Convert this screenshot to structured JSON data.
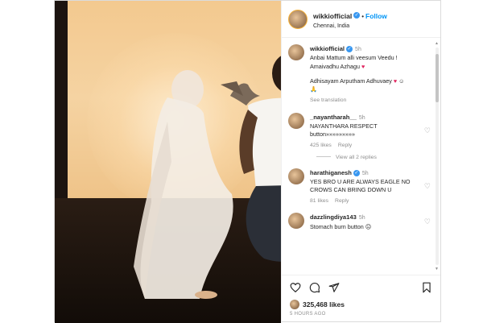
{
  "post": {
    "username": "wikkiofficial",
    "follow_label": "Follow",
    "location": "Chennai, India"
  },
  "comments": [
    {
      "username": "wikkiofficial",
      "time": "5h",
      "text_line1": "Anbai Mattum alli veesum Veedu !",
      "text_line2": "Amaivadhu Azhagu",
      "text_line3": "Adhisayam Arputham Adhuvaey",
      "extra_line": "🙏",
      "see_translation": "See translation"
    },
    {
      "username": "_nayantharah__",
      "time": "5h",
      "text_line1": "NAYANTHARA RESPECT",
      "text_line2": "button»»»»»»»»»",
      "likes": "425 likes",
      "reply": "Reply",
      "view_replies": "View all 2 replies"
    },
    {
      "username": "harathiganesh",
      "time": "5h",
      "text": "YES BRO U ARE ALWAYS EAGLE NO CROWS CAN BRING DOWN U",
      "likes": "81 likes",
      "reply": "Reply"
    },
    {
      "username": "dazzlingdiya143",
      "time": "5h",
      "text": "Stomach burn button"
    }
  ],
  "footer": {
    "likes_count": "325,468 likes",
    "time_ago": "5 HOURS AGO"
  },
  "icons": [
    "heart-icon",
    "comment-icon",
    "share-icon",
    "bookmark-icon",
    "verified-icon"
  ],
  "colors": {
    "accent": "#0095f6",
    "verified": "#3897f0",
    "heart": "#e0245e"
  }
}
